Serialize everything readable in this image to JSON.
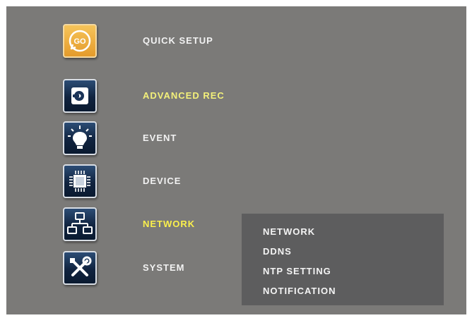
{
  "menu": {
    "items": [
      {
        "label": "QUICK SETUP",
        "icon": "go-icon",
        "state": "normal"
      },
      {
        "label": "ADVANCED REC",
        "icon": "hard-disk-icon",
        "state": "accent"
      },
      {
        "label": "EVENT",
        "icon": "light-bulb-icon",
        "state": "normal"
      },
      {
        "label": "DEVICE",
        "icon": "chip-icon",
        "state": "normal"
      },
      {
        "label": "NETWORK",
        "icon": "network-icon",
        "state": "active"
      },
      {
        "label": "SYSTEM",
        "icon": "tools-icon",
        "state": "normal"
      }
    ]
  },
  "go_icon_text": "GO",
  "submenu": {
    "items": [
      {
        "label": "NETWORK"
      },
      {
        "label": "DDNS"
      },
      {
        "label": "NTP SETTING"
      },
      {
        "label": "NOTIFICATION"
      }
    ]
  },
  "colors": {
    "background": "#7b7a78",
    "submenu_panel": "#5d5d5e",
    "active_label": "#fbf04c",
    "accent_label": "#f3f07a",
    "label": "#f2f2f2"
  }
}
